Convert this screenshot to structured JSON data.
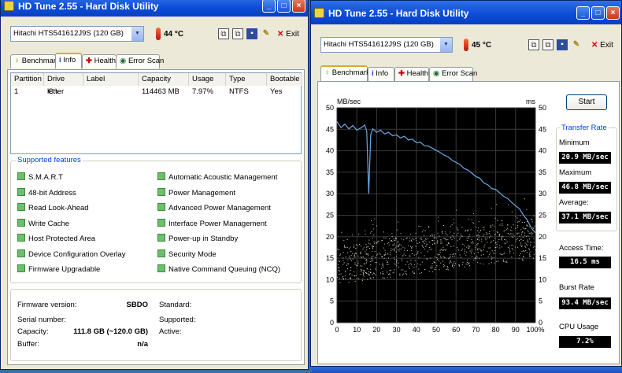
{
  "left_window": {
    "title": "HD Tune 2.55 - Hard Disk Utility",
    "drive": "Hitachi HTS541612J9S (120 GB)",
    "temperature": "44 °C",
    "exit_label": "Exit",
    "tabs": [
      {
        "label": "Benchmark",
        "icon": "benchmark-icon"
      },
      {
        "label": "Info",
        "icon": "info-icon"
      },
      {
        "label": "Health",
        "icon": "health-icon"
      },
      {
        "label": "Error Scan",
        "icon": "scan-icon"
      }
    ],
    "active_tab": "Info",
    "partition_table": {
      "columns": [
        "Partition",
        "Drive letter",
        "Label",
        "Capacity",
        "Usage",
        "Type",
        "Bootable"
      ],
      "rows": [
        [
          "1",
          "C:\\",
          "",
          "114463 MB",
          "7.97%",
          "NTFS",
          "Yes"
        ]
      ]
    },
    "supported_features_title": "Supported features",
    "features_left": [
      "S.M.A.R.T",
      "48-bit Address",
      "Read Look-Ahead",
      "Write Cache",
      "Host Protected Area",
      "Device Configuration Overlay",
      "Firmware Upgradable"
    ],
    "features_right": [
      "Automatic Acoustic Management",
      "Power Management",
      "Advanced Power Management",
      "Interface Power Management",
      "Power-up in Standby",
      "Security Mode",
      "Native Command Queuing (NCQ)"
    ],
    "details": {
      "firmware_label": "Firmware version:",
      "firmware_value": "SBDO",
      "serial_label": "Serial number:",
      "serial_value": "",
      "capacity_label": "Capacity:",
      "capacity_value": "111.8 GB (~120.0 GB)",
      "buffer_label": "Buffer:",
      "buffer_value": "n/a",
      "standard_label": "Standard:",
      "supported_label": "Supported:",
      "active_label": "Active:"
    }
  },
  "right_window": {
    "title": "HD Tune 2.55 - Hard Disk Utility",
    "drive": "Hitachi HTS541612J9S (120 GB)",
    "temperature": "45 °C",
    "exit_label": "Exit",
    "tabs": [
      {
        "label": "Benchmark",
        "icon": "benchmark-icon"
      },
      {
        "label": "Info",
        "icon": "info-icon"
      },
      {
        "label": "Health",
        "icon": "health-icon"
      },
      {
        "label": "Error Scan",
        "icon": "scan-icon"
      }
    ],
    "active_tab": "Benchmark",
    "start_label": "Start",
    "transfer_rate_title": "Transfer Rate",
    "minimum_label": "Minimum",
    "minimum_value": "20.9 MB/sec",
    "maximum_label": "Maximum",
    "maximum_value": "46.8 MB/sec",
    "average_label": "Average:",
    "average_value": "37.1 MB/sec",
    "access_label": "Access Time:",
    "access_value": "16.5 ms",
    "burst_label": "Burst Rate",
    "burst_value": "93.4 MB/sec",
    "cpu_label": "CPU Usage",
    "cpu_value": "7.2%"
  },
  "chart_data": {
    "type": "line",
    "ylabel": "MB/sec",
    "y2label": "ms",
    "ylim": [
      0,
      50
    ],
    "y2lim": [
      0,
      50
    ],
    "xlim": [
      0,
      100
    ],
    "yticks": [
      "0",
      "5",
      "10",
      "15",
      "20",
      "25",
      "30",
      "35",
      "40",
      "45",
      "50"
    ],
    "xticks": [
      "0",
      "10",
      "20",
      "30",
      "40",
      "50",
      "60",
      "70",
      "80",
      "90",
      "100%"
    ],
    "grid": true,
    "colors": {
      "background": "#000000",
      "grid": "#3a3a3a",
      "transfer_line": "#6aa8e0",
      "access_points": "#d8d8c8"
    },
    "series": [
      {
        "x": [
          0,
          2,
          4,
          6,
          8,
          10,
          12,
          14,
          15,
          16,
          17,
          18,
          20,
          22,
          24,
          26,
          28,
          30,
          32,
          34,
          36,
          38,
          40,
          42,
          44,
          46,
          48,
          50,
          52,
          54,
          56,
          58,
          60,
          62,
          64,
          66,
          68,
          70,
          72,
          74,
          76,
          78,
          80,
          82,
          84,
          86,
          88,
          90,
          92,
          94,
          96,
          98,
          100
        ],
        "y": [
          46.8,
          45.4,
          46.2,
          45.1,
          45.9,
          44.8,
          45.3,
          46.0,
          44.5,
          30.0,
          43.7,
          45.1,
          44.3,
          44.8,
          43.9,
          44.3,
          43.5,
          43.7,
          43.0,
          43.4,
          42.5,
          42.7,
          41.9,
          42.0,
          41.2,
          41.1,
          40.6,
          40.1,
          39.6,
          39.0,
          38.6,
          37.8,
          37.3,
          36.8,
          35.9,
          35.5,
          34.8,
          34.0,
          33.6,
          32.5,
          32.1,
          31.2,
          31.0,
          30.2,
          29.4,
          28.9,
          28.0,
          27.2,
          26.5,
          25.0,
          23.8,
          22.0,
          20.9
        ]
      }
    ]
  }
}
